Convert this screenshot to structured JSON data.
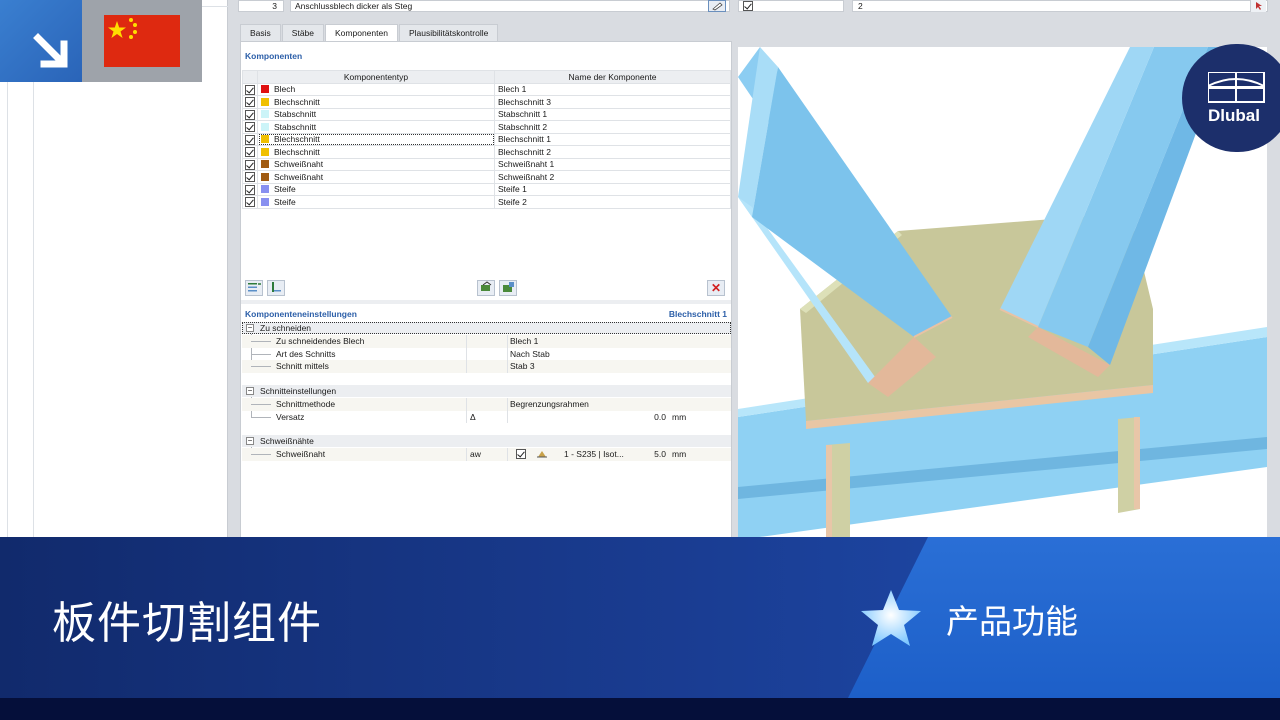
{
  "top_row": {
    "connection_number": "3",
    "connection_text": "Anschlussblech dicker als Steg",
    "member_value": "2"
  },
  "tabs": [
    {
      "label": "Basis",
      "active": false
    },
    {
      "label": "Stäbe",
      "active": false
    },
    {
      "label": "Komponenten",
      "active": true
    },
    {
      "label": "Plausibilitätskontrolle",
      "active": false
    }
  ],
  "components": {
    "title": "Komponenten",
    "col_type": "Komponententyp",
    "col_name": "Name der Komponente",
    "rows": [
      {
        "type": "Blech",
        "name": "Blech 1",
        "color": "#e01010"
      },
      {
        "type": "Blechschnitt",
        "name": "Blechschnitt 3",
        "color": "#f0c000"
      },
      {
        "type": "Stabschnitt",
        "name": "Stabschnitt 1",
        "color": "#ccf4f8"
      },
      {
        "type": "Stabschnitt",
        "name": "Stabschnitt 2",
        "color": "#ccf4f8"
      },
      {
        "type": "Blechschnitt",
        "name": "Blechschnitt 1",
        "color": "#f0c000"
      },
      {
        "type": "Blechschnitt",
        "name": "Blechschnitt 2",
        "color": "#f0c000"
      },
      {
        "type": "Schweißnaht",
        "name": "Schweißnaht 1",
        "color": "#a05a10"
      },
      {
        "type": "Schweißnaht",
        "name": "Schweißnaht 2",
        "color": "#a05a10"
      },
      {
        "type": "Steife",
        "name": "Steife 1",
        "color": "#8890f0"
      },
      {
        "type": "Steife",
        "name": "Steife 2",
        "color": "#8890f0"
      }
    ]
  },
  "settings": {
    "title": "Komponenteneinstellungen",
    "selected": "Blechschnitt 1",
    "group_cut": "Zu schneiden",
    "plate_to_cut_label": "Zu schneidendes Blech",
    "plate_to_cut_value": "Blech 1",
    "cut_type_label": "Art des Schnitts",
    "cut_type_value": "Nach Stab",
    "cut_by_label": "Schnitt mittels",
    "cut_by_value": "Stab 3",
    "group_cut_settings": "Schnitteinstellungen",
    "cut_method_label": "Schnittmethode",
    "cut_method_value": "Begrenzungsrahmen",
    "offset_label": "Versatz",
    "offset_symbol": "Δ",
    "offset_value": "0.0",
    "offset_unit": "mm",
    "group_welds": "Schweißnähte",
    "weld_label": "Schweißnaht",
    "weld_symbol": "aw",
    "weld_material": "1 - S235 | Isot...",
    "weld_value": "5.0",
    "weld_unit": "mm"
  },
  "logo_text": "Dlubal",
  "banner": {
    "title": "板件切割组件",
    "feature": "产品功能"
  },
  "colors": {
    "banner_dark": "#112a6c",
    "banner_accent": "#1f4fb3",
    "section_title": "#2b5ea8",
    "beam_blue": "#86cdf0",
    "plate": "#c8c79a"
  }
}
